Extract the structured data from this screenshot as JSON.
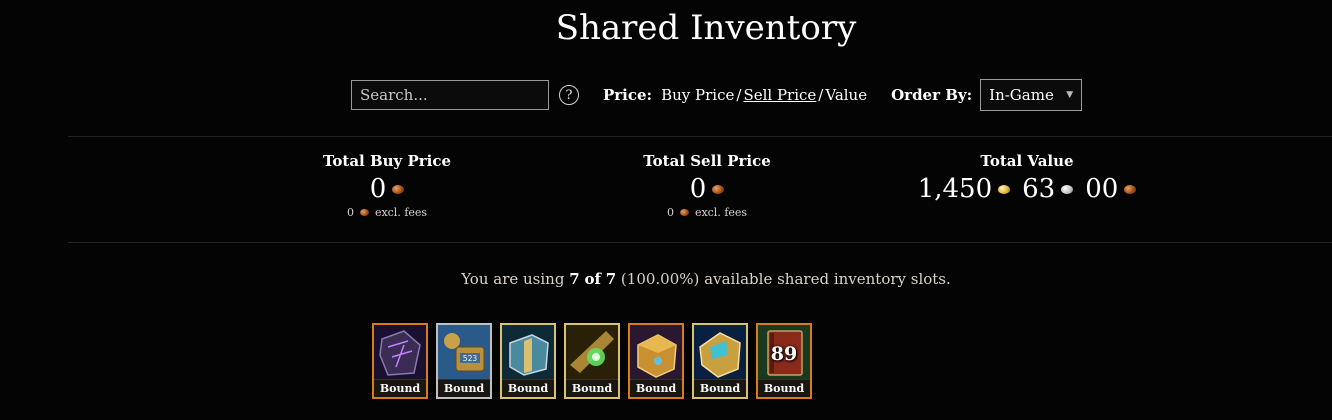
{
  "page": {
    "title": "Shared Inventory"
  },
  "controls": {
    "search_placeholder": "Search...",
    "help_label": "?",
    "price_label": "Price:",
    "price_options": [
      "Buy Price",
      "Sell Price",
      "Value"
    ],
    "price_selected": "Sell Price",
    "price_separator": "/",
    "order_label": "Order By:",
    "order_value": "In-Game"
  },
  "totals": {
    "buy": {
      "label": "Total Buy Price",
      "value": "0",
      "fee_value": "0",
      "fee_label": "excl. fees"
    },
    "sell": {
      "label": "Total Sell Price",
      "value": "0",
      "fee_value": "0",
      "fee_label": "excl. fees"
    },
    "value": {
      "label": "Total Value",
      "gold": "1,450",
      "silver": "63",
      "copper": "00"
    }
  },
  "usage": {
    "prefix": "You are using",
    "used": "7",
    "of": "of",
    "total": "7",
    "percent": "(100.00%)",
    "suffix": "available shared inventory slots."
  },
  "slots": [
    {
      "label": "Bound",
      "icon": "dark-crate-icon",
      "rarity_color": "#d87a1e"
    },
    {
      "label": "Bound",
      "icon": "golem-banker-icon",
      "rarity_color": "#c0c0c0"
    },
    {
      "label": "Bound",
      "icon": "teal-chest-icon",
      "rarity_color": "#d8c470"
    },
    {
      "label": "Bound",
      "icon": "glowing-crystal-icon",
      "rarity_color": "#d8c470"
    },
    {
      "label": "Bound",
      "icon": "gold-box-icon",
      "rarity_color": "#d87a1e"
    },
    {
      "label": "Bound",
      "icon": "ornate-gold-chest-icon",
      "rarity_color": "#d8c470"
    },
    {
      "label": "Bound",
      "icon": "red-tome-icon",
      "rarity_color": "#d87a1e",
      "quantity": "89"
    }
  ]
}
